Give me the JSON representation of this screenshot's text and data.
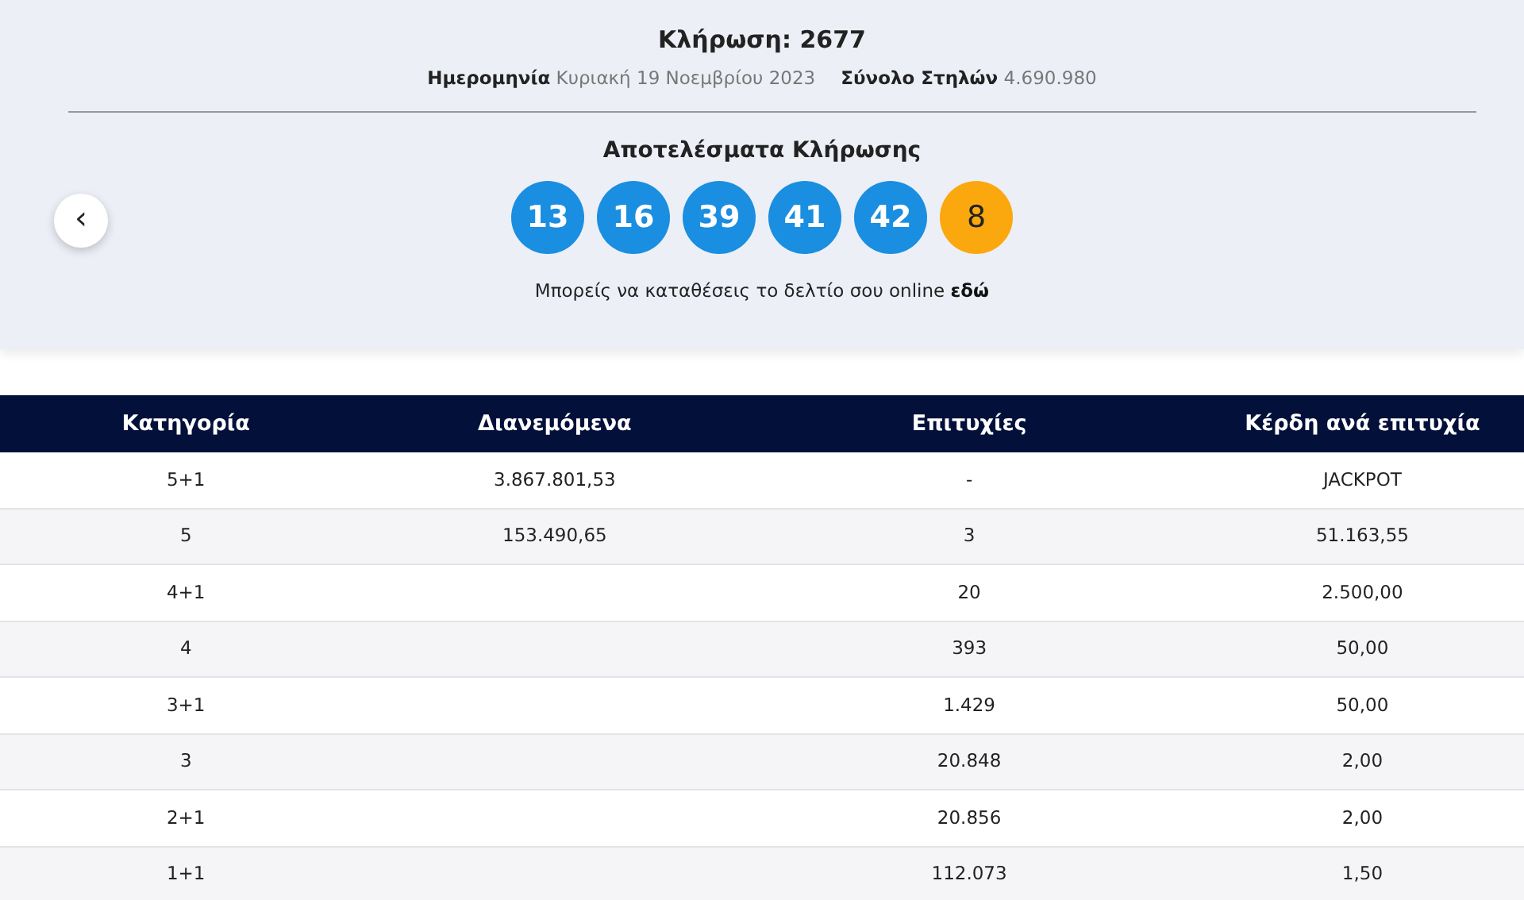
{
  "draw": {
    "title": "Κλήρωση: 2677",
    "date_label": "Ημερομηνία",
    "date": "Κυριακή 19 Νοεμβρίου 2023",
    "columns_label": "Σύνολο Στηλών",
    "columns_total": "4.690.980"
  },
  "back_button": {
    "label": "‹"
  },
  "results": {
    "title": "Αποτελέσματα Κλήρωσης",
    "balls": [
      {
        "number": "13",
        "kind": "main"
      },
      {
        "number": "16",
        "kind": "main"
      },
      {
        "number": "39",
        "kind": "main"
      },
      {
        "number": "41",
        "kind": "main"
      },
      {
        "number": "42",
        "kind": "main"
      },
      {
        "number": "8",
        "kind": "bonus"
      }
    ],
    "note": "Μπορείς να καταθέσεις το δελτίο σου online",
    "note_link": "εδώ"
  },
  "table": {
    "columns": [
      "Κατηγορία",
      "Διανεμόμενα",
      "Επιτυχίες",
      "Κέρδη ανά επιτυχία"
    ],
    "rows": [
      [
        "5+1",
        "3.867.801,53",
        "-",
        "JACKPOT"
      ],
      [
        "5",
        "153.490,65",
        "3",
        "51.163,55"
      ],
      [
        "4+1",
        "",
        "20",
        "2.500,00"
      ],
      [
        "4",
        "",
        "393",
        "50,00"
      ],
      [
        "3+1",
        "",
        "1.429",
        "50,00"
      ],
      [
        "3",
        "",
        "20.848",
        "2,00"
      ],
      [
        "2+1",
        "",
        "20.856",
        "2,00"
      ],
      [
        "1+1",
        "",
        "112.073",
        "1,50"
      ]
    ]
  }
}
